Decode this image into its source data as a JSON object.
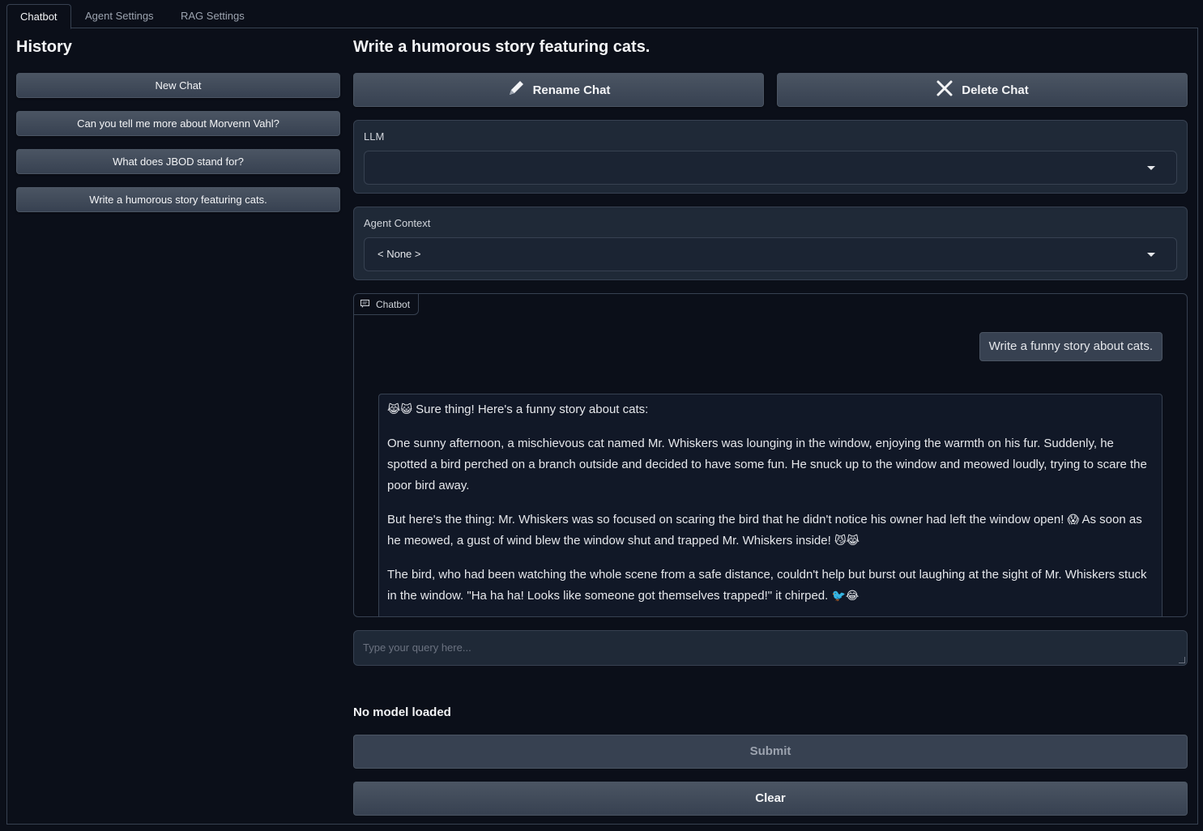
{
  "tabs": [
    "Chatbot",
    "Agent Settings",
    "RAG Settings"
  ],
  "sidebar": {
    "title": "History",
    "items": [
      "New Chat",
      "Can you tell me more about Morvenn Vahl?",
      "What does JBOD stand for?",
      "Write a humorous story featuring cats."
    ]
  },
  "main": {
    "title": "Write a humorous story featuring cats.",
    "rename_label": "Rename Chat",
    "delete_label": "Delete Chat",
    "llm": {
      "label": "LLM",
      "value": ""
    },
    "agent_context": {
      "label": "Agent Context",
      "value": "< None >"
    },
    "chatbot_label": "Chatbot",
    "messages": {
      "user": "Write a funny story about cats.",
      "bot_p1": "Sure thing! Here's a funny story about cats:",
      "bot_p2": "One sunny afternoon, a mischievous cat named Mr. Whiskers was lounging in the window, enjoying the warmth on his fur. Suddenly, he spotted a bird perched on a branch outside and decided to have some fun. He snuck up to the window and meowed loudly, trying to scare the poor bird away.",
      "bot_p3a": "But here's the thing: Mr. Whiskers was so focused on scaring the bird that he didn't notice his owner had left the window open!",
      "bot_p3b": "As soon as he meowed, a gust of wind blew the window shut and trapped Mr. Whiskers inside!",
      "bot_p4": "The bird, who had been watching the whole scene from a safe distance, couldn't help but burst out laughing at the sight of Mr. Whiskers stuck in the window. \"Ha ha ha! Looks like someone got themselves trapped!\" it chirped."
    },
    "query_placeholder": "Type your query here...",
    "status": "No model loaded",
    "submit_label": "Submit",
    "clear_label": "Clear"
  },
  "icons": {
    "rename": "pencil-icon",
    "delete": "x-icon",
    "chatbot": "chat-icon"
  }
}
